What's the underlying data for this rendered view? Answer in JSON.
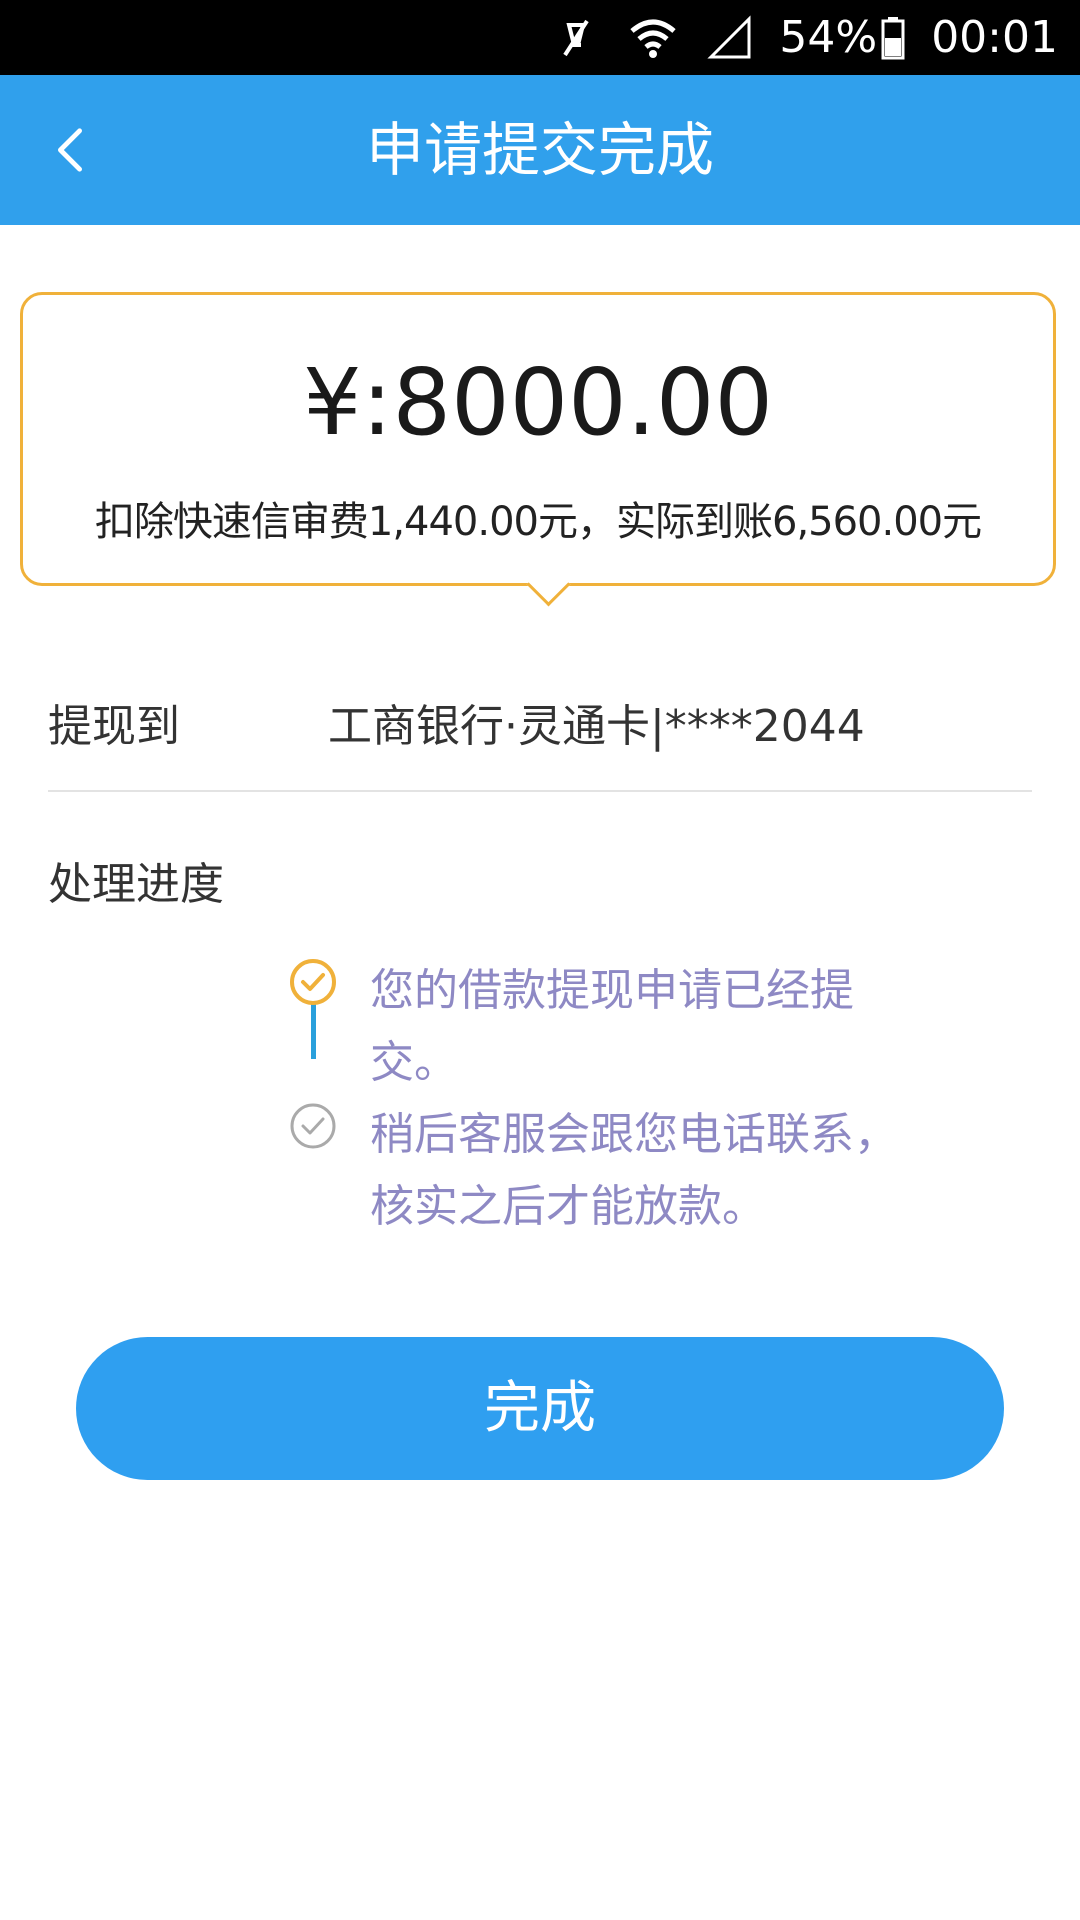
{
  "status_bar": {
    "battery": "54%",
    "time": "00:01"
  },
  "app_bar": {
    "title": "申请提交完成"
  },
  "amount_card": {
    "amount": "¥:8000.00",
    "note": "扣除快速信审费1,440.00元，实际到账6,560.00元"
  },
  "withdraw": {
    "label": "提现到",
    "value": "工商银行·灵通卡|****2044"
  },
  "progress": {
    "title": "处理进度",
    "steps": [
      {
        "text": "您的借款提现申请已经提交。",
        "state": "done"
      },
      {
        "text": "稍后客服会跟您电话联系，核实之后才能放款。",
        "state": "pending"
      }
    ]
  },
  "done_button": {
    "label": "完成"
  },
  "colors": {
    "app_bar": "#30a0ec",
    "card_border": "#f0b13a",
    "step_text": "#8e89c4",
    "button": "#2f9ff0"
  }
}
